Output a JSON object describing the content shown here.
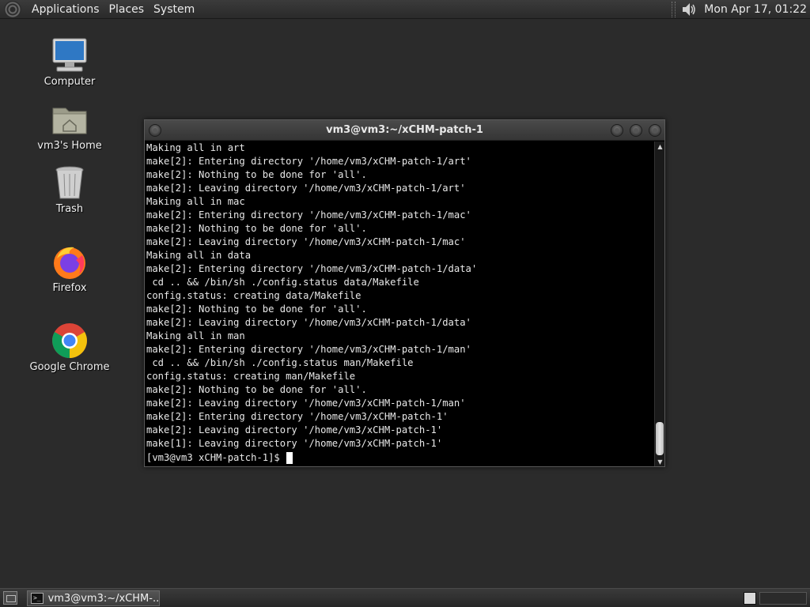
{
  "top_panel": {
    "menus": [
      "Applications",
      "Places",
      "System"
    ],
    "clock": "Mon Apr 17, 01:22"
  },
  "desktop": {
    "icons": [
      {
        "label": "Computer",
        "icon": "computer-icon"
      },
      {
        "label": "vm3's Home",
        "icon": "home-folder-icon"
      },
      {
        "label": "Trash",
        "icon": "trash-icon"
      },
      {
        "label": "Firefox",
        "icon": "firefox-icon"
      },
      {
        "label": "Google Chrome",
        "icon": "chrome-icon"
      }
    ]
  },
  "terminal": {
    "title": "vm3@vm3:~/xCHM-patch-1",
    "lines": [
      "Making all in art",
      "make[2]: Entering directory '/home/vm3/xCHM-patch-1/art'",
      "make[2]: Nothing to be done for 'all'.",
      "make[2]: Leaving directory '/home/vm3/xCHM-patch-1/art'",
      "Making all in mac",
      "make[2]: Entering directory '/home/vm3/xCHM-patch-1/mac'",
      "make[2]: Nothing to be done for 'all'.",
      "make[2]: Leaving directory '/home/vm3/xCHM-patch-1/mac'",
      "Making all in data",
      "make[2]: Entering directory '/home/vm3/xCHM-patch-1/data'",
      " cd .. && /bin/sh ./config.status data/Makefile",
      "config.status: creating data/Makefile",
      "make[2]: Nothing to be done for 'all'.",
      "make[2]: Leaving directory '/home/vm3/xCHM-patch-1/data'",
      "Making all in man",
      "make[2]: Entering directory '/home/vm3/xCHM-patch-1/man'",
      " cd .. && /bin/sh ./config.status man/Makefile",
      "config.status: creating man/Makefile",
      "make[2]: Nothing to be done for 'all'.",
      "make[2]: Leaving directory '/home/vm3/xCHM-patch-1/man'",
      "make[2]: Entering directory '/home/vm3/xCHM-patch-1'",
      "make[2]: Leaving directory '/home/vm3/xCHM-patch-1'",
      "make[1]: Leaving directory '/home/vm3/xCHM-patch-1'"
    ],
    "prompt": "[vm3@vm3 xCHM-patch-1]$"
  },
  "taskbar": {
    "tasks": [
      {
        "label": "vm3@vm3:~/xCHM-...",
        "icon": "terminal-icon"
      }
    ]
  }
}
